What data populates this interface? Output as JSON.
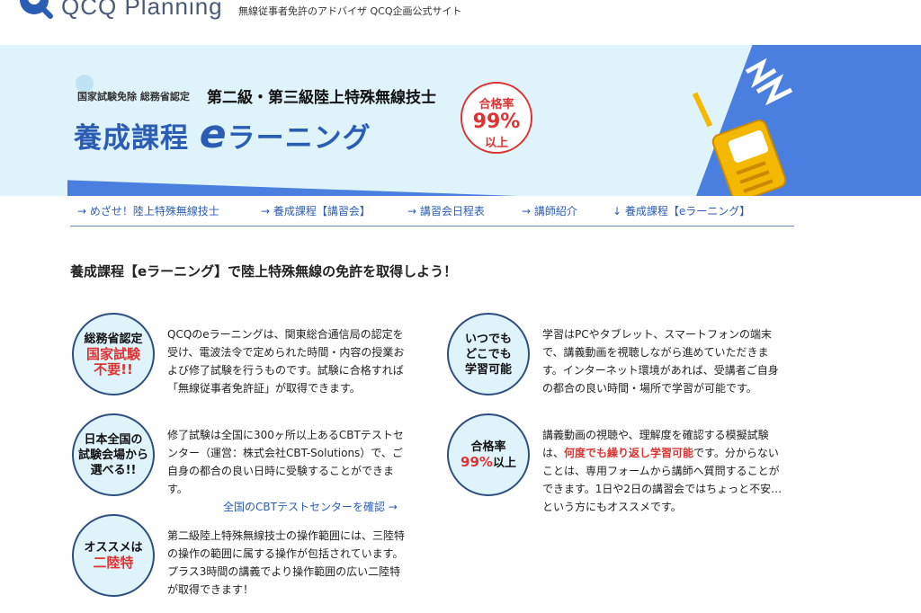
{
  "header": {
    "logo_text": "QCQ Planning",
    "tagline": "無線従事者免許のアドバイザ QCQ企画公式サイト"
  },
  "hero": {
    "sub": "国家試験免除 総務省認定",
    "title": "第二級・第三級陸上特殊無線技士",
    "main_prefix": "養成課程",
    "main_e": "e",
    "main_suffix": "ラーニング",
    "badge_line1": "合格率",
    "badge_line2": "99%",
    "badge_line3": "以上"
  },
  "nav": [
    {
      "label": "→ めざせ！陸上特殊無線技士"
    },
    {
      "label": "→ 養成課程【講習会】"
    },
    {
      "label": "→ 講習会日程表"
    },
    {
      "label": "→ 講師紹介"
    },
    {
      "label": "↓ 養成課程【eラーニング】"
    }
  ],
  "intro": "養成課程【eラーニング】で陸上特殊無線の免許を取得しよう！",
  "features": [
    {
      "badge_line1": "総務省認定",
      "badge_red": "国家試験",
      "badge_red2": "不要!!",
      "text": "QCQのeラーニングは、関東総合通信局の認定を受け、電波法令で定められた時間・内容の授業および修了試験を行うものです。試験に合格すれば「無線従事者免許証」が取得できます。"
    },
    {
      "badge_line1": "日本全国の",
      "badge_line2": "試験会場から",
      "badge_line3": "選べる!!",
      "text": "修了試験は全国に300ヶ所以上あるCBTテストセンター（運営：株式会社CBT-Solutions）で、ご自身の都合の良い日時に受験することができます。",
      "link": "全国のCBTテストセンターを確認 →"
    },
    {
      "badge_line1": "オススメは",
      "badge_red": "二陸特",
      "text": "第二級陸上特殊無線技士の操作範囲には、三陸特の操作の範囲に属する操作が包括されています。プラス3時間の講義でより操作範囲の広い二陸特が取得できます！"
    },
    {
      "badge_line1": "いつでも",
      "badge_line2": "どこでも",
      "badge_line3": "学習可能",
      "text": "学習はPCやタブレット、スマートフォンの端末で、講義動画を視聴しながら進めていただきます。インターネット環境があれば、受講者ご自身の都合の良い時間・場所で学習が可能です。"
    },
    {
      "badge_line1": "合格率",
      "badge_red": "99%",
      "badge_suffix": "以上",
      "text_pre": "講義動画の視聴や、理解度を確認する模擬試験は、",
      "text_hl": "何度でも繰り返し学習可能",
      "text_post": "です。分からないことは、専用フォームから講師へ質問することができます。1日や2日の講習会ではちょっと不安…という方にもオススメです。"
    }
  ],
  "colors": {
    "accent": "#2c5db5",
    "red": "#d33",
    "hero_bg": "#dff3fb",
    "blue": "#4a7fe0"
  }
}
